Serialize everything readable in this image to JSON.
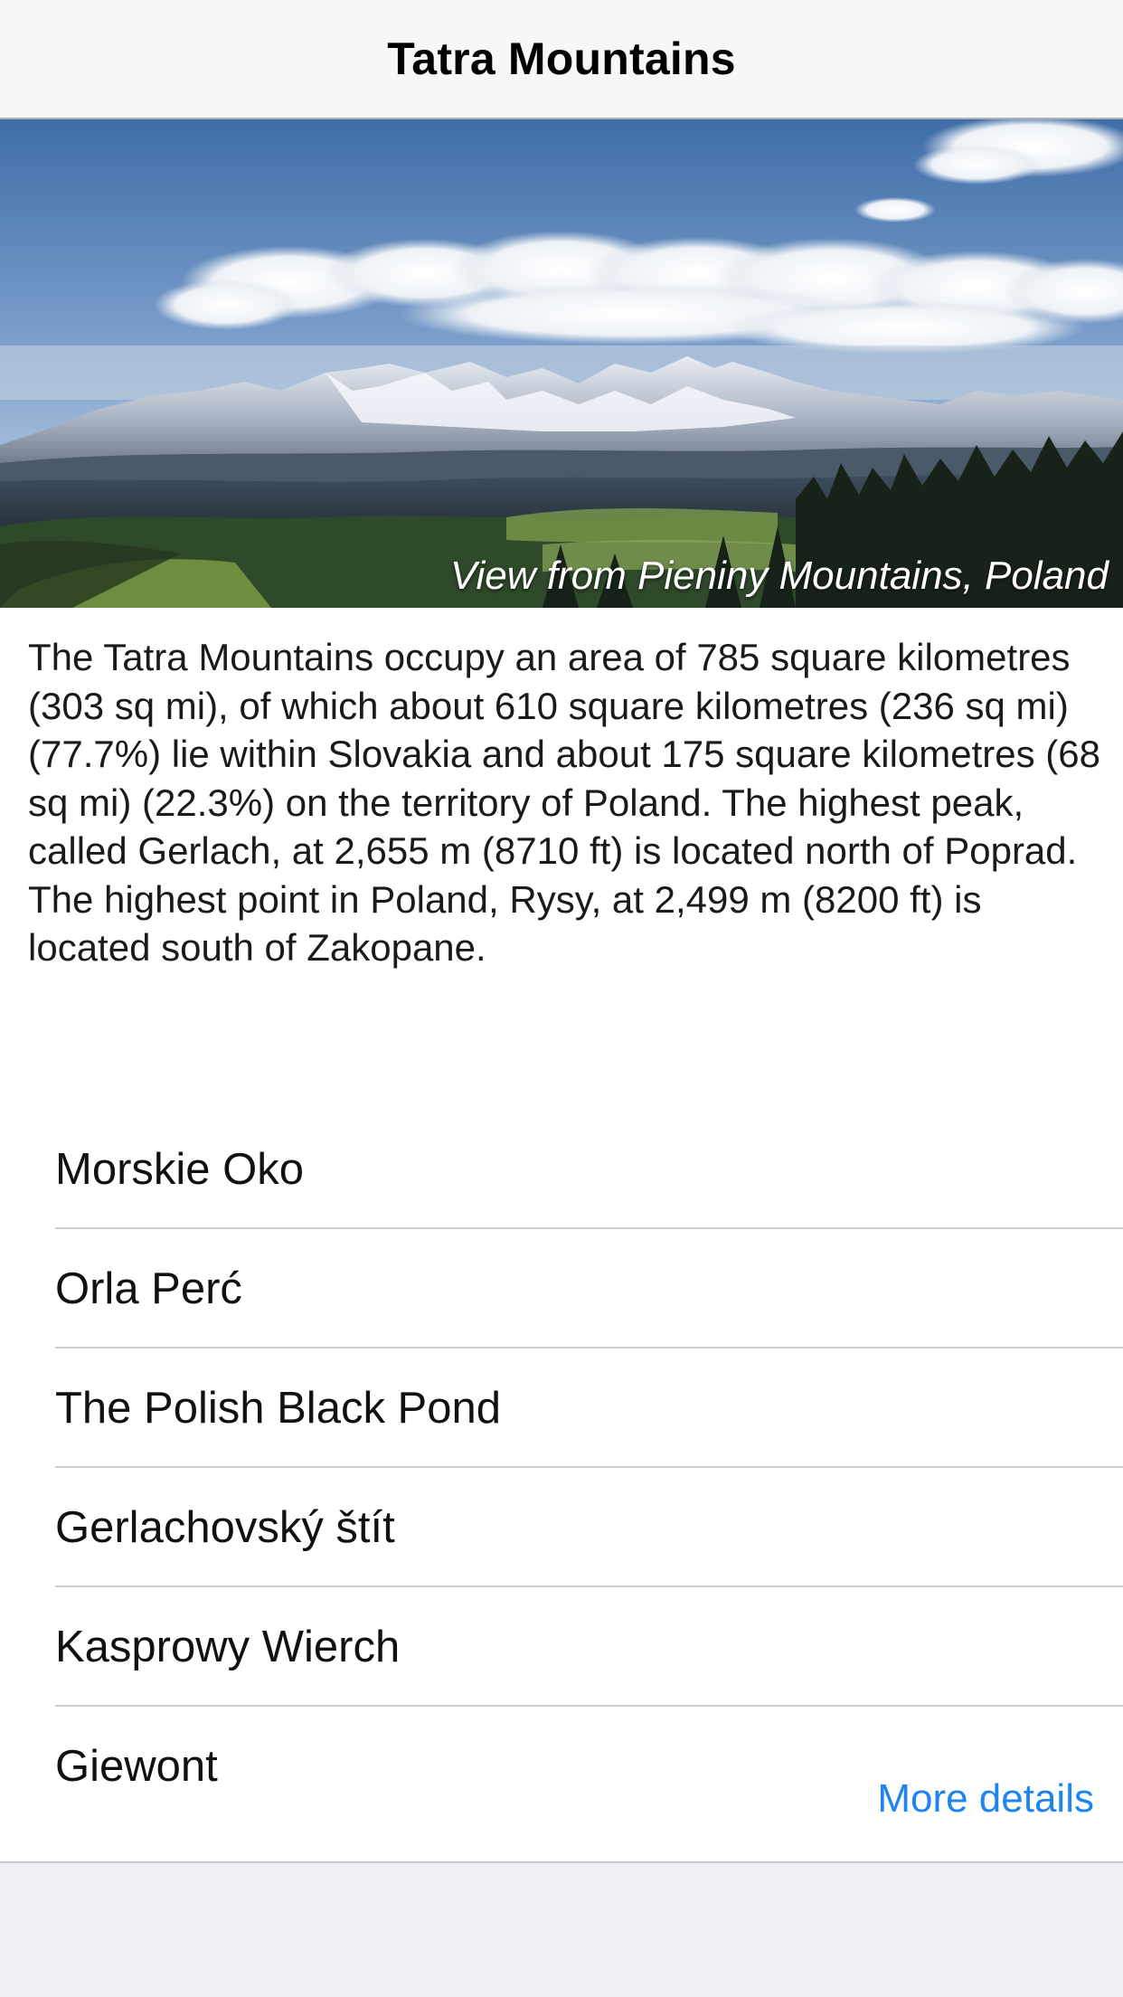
{
  "navbar": {
    "title": "Tatra Mountains"
  },
  "hero": {
    "caption": "View from Pieniny Mountains, Poland"
  },
  "description": "The Tatra Mountains occupy an area of 785 square kilometres (303 sq mi), of which about 610 square kilometres (236 sq mi) (77.7%) lie within Slovakia and about 175 square kilometres (68 sq mi) (22.3%) on the territory of Poland. The highest peak, called Gerlach, at 2,655 m (8710 ft) is located north of Poprad. The highest point in Poland, Rysy, at 2,499 m (8200 ft) is located south of Zakopane.",
  "places": [
    {
      "label": "Morskie Oko"
    },
    {
      "label": "Orla Perć"
    },
    {
      "label": "The Polish Black Pond"
    },
    {
      "label": "Gerlachovský štít"
    },
    {
      "label": "Kasprowy Wierch"
    },
    {
      "label": "Giewont"
    }
  ],
  "more_details_label": "More details",
  "colors": {
    "link": "#1d84f0",
    "background": "#efeff4",
    "card": "#ffffff",
    "separator": "#cfcfd4"
  }
}
